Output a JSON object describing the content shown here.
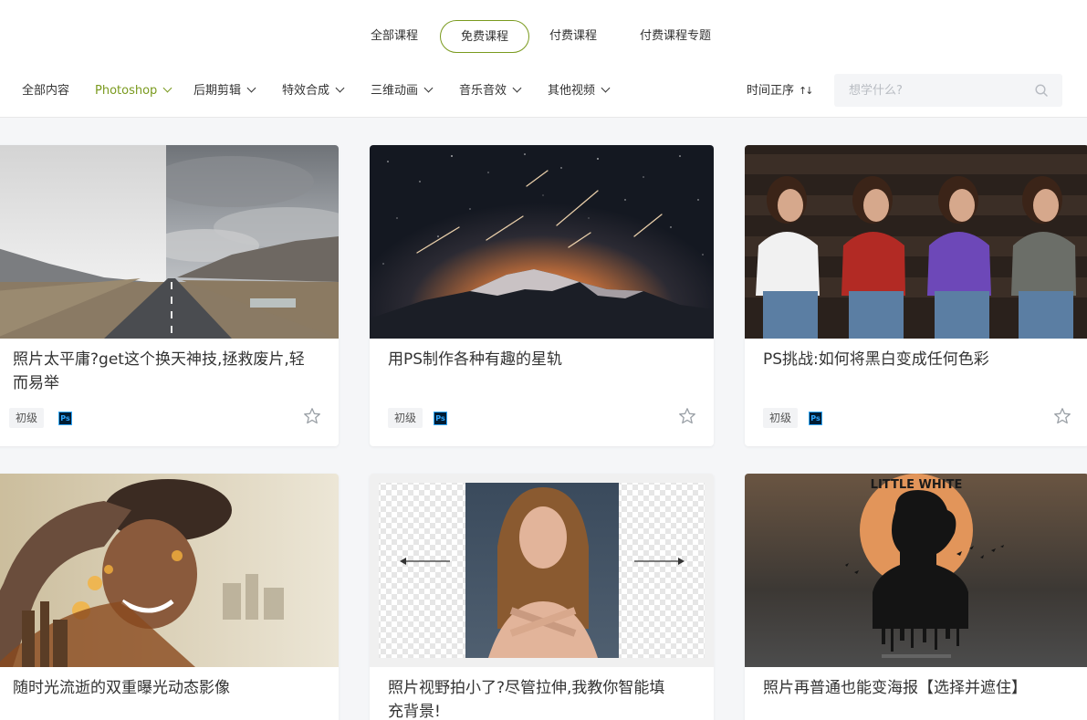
{
  "tabs": [
    {
      "label": "全部课程",
      "active": false
    },
    {
      "label": "免费课程",
      "active": true
    },
    {
      "label": "付费课程",
      "active": false
    },
    {
      "label": "付费课程专题",
      "active": false
    }
  ],
  "categories": [
    {
      "label": "全部内容",
      "active": false,
      "dropdown": false
    },
    {
      "label": "Photoshop",
      "active": true,
      "dropdown": true
    },
    {
      "label": "后期剪辑",
      "active": false,
      "dropdown": true
    },
    {
      "label": "特效合成",
      "active": false,
      "dropdown": true
    },
    {
      "label": "三维动画",
      "active": false,
      "dropdown": true
    },
    {
      "label": "音乐音效",
      "active": false,
      "dropdown": true
    },
    {
      "label": "其他视频",
      "active": false,
      "dropdown": true
    }
  ],
  "sort": {
    "label": "时间正序",
    "icon": "↑↓"
  },
  "search": {
    "placeholder": "想学什么?",
    "icon": "search-icon"
  },
  "colors": {
    "accent": "#7a9a1e",
    "ps_badge_bg": "#001d34",
    "ps_badge_fg": "#31a8ff"
  },
  "courses": [
    {
      "title": "照片太平庸?get这个换天神技,拯救废片,轻而易举",
      "level": "初级",
      "software": "Ps",
      "favorite_icon": "star-outline-icon"
    },
    {
      "title": "用PS制作各种有趣的星轨",
      "level": "初级",
      "software": "Ps",
      "favorite_icon": "star-outline-icon"
    },
    {
      "title": "PS挑战:如何将黑白变成任何色彩",
      "level": "初级",
      "software": "Ps",
      "favorite_icon": "star-outline-icon"
    },
    {
      "title": "随时光流逝的双重曝光动态影像"
    },
    {
      "title": "照片视野拍小了?尽管拉伸,我教你智能填充背景!"
    },
    {
      "title": "照片再普通也能变海报【选择并遮住】",
      "poster_text": "LITTLE WHITE"
    }
  ]
}
